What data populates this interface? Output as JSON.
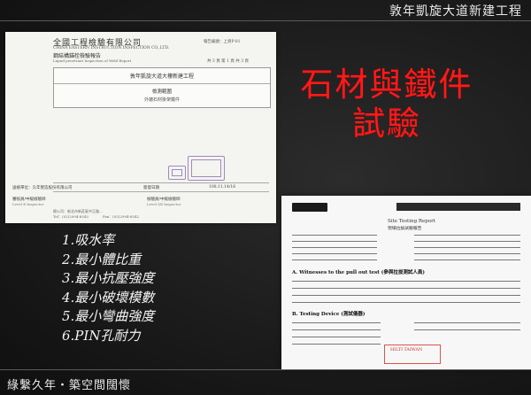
{
  "header": {
    "title": "敦年凱旋大道新建工程"
  },
  "footer": {
    "tagline": "綠繫久年・築空間闊懷"
  },
  "main_title": {
    "line1": "石材與鐵件",
    "line2": "試驗"
  },
  "test_items": [
    "1.吸水率",
    "2.最小體比重",
    "3.最小抗壓強度",
    "4.最小破壞模數",
    "5.最小彎曲強度",
    "6.PIN孔耐力"
  ],
  "report_left": {
    "company": "全國工程檢驗有限公司",
    "company_en": "CHINA EASTERN INSTRUCTION INSPECTION CO.,LTD.",
    "report_name": "鋼結構錨栓檢驗報告",
    "report_name_en": "Liquid penetrant Inspection of Weld Report",
    "doc_no": "報告編號：上頁P-01",
    "page_no": "共 3 頁 第 1 頁 共 3 頁",
    "project": "敦年凱旋大道大樓新建工程",
    "scope_label": "檢測範圍",
    "scope_value": "外牆石材掛架鐵件",
    "unit_label": "送檢單位：久年營造股份有限公司",
    "date_label": "簽發日期",
    "date_value": "108.11.14/16",
    "sign_left": "審核員/中級檢驗師",
    "sign_left_en": "Level Ⅱ Inspector",
    "sign_right": "檢驗員/中級檢驗師",
    "sign_right_en": "Level Ⅰ/Ⅱ Inspector",
    "addr1": "總公司：新北市新莊區中正路…",
    "addr2": "Tel：(02)2994-8543",
    "addr3": "Fax：(02)2994-8542"
  },
  "report_right": {
    "brand": "HILTI",
    "title": "Site Testing Report",
    "title_zh": "現場拉拔試驗報告",
    "section_a": "A. Witnesses to the pull out test (參與拉拔測試人員)",
    "section_b": "B. Testing Device (測試儀器)",
    "stamp_text": "HILTI TAIWAN"
  },
  "colors": {
    "title_red": "#ff1a1a",
    "background": "#1b1b1b",
    "text_light": "#f3f3f3"
  }
}
